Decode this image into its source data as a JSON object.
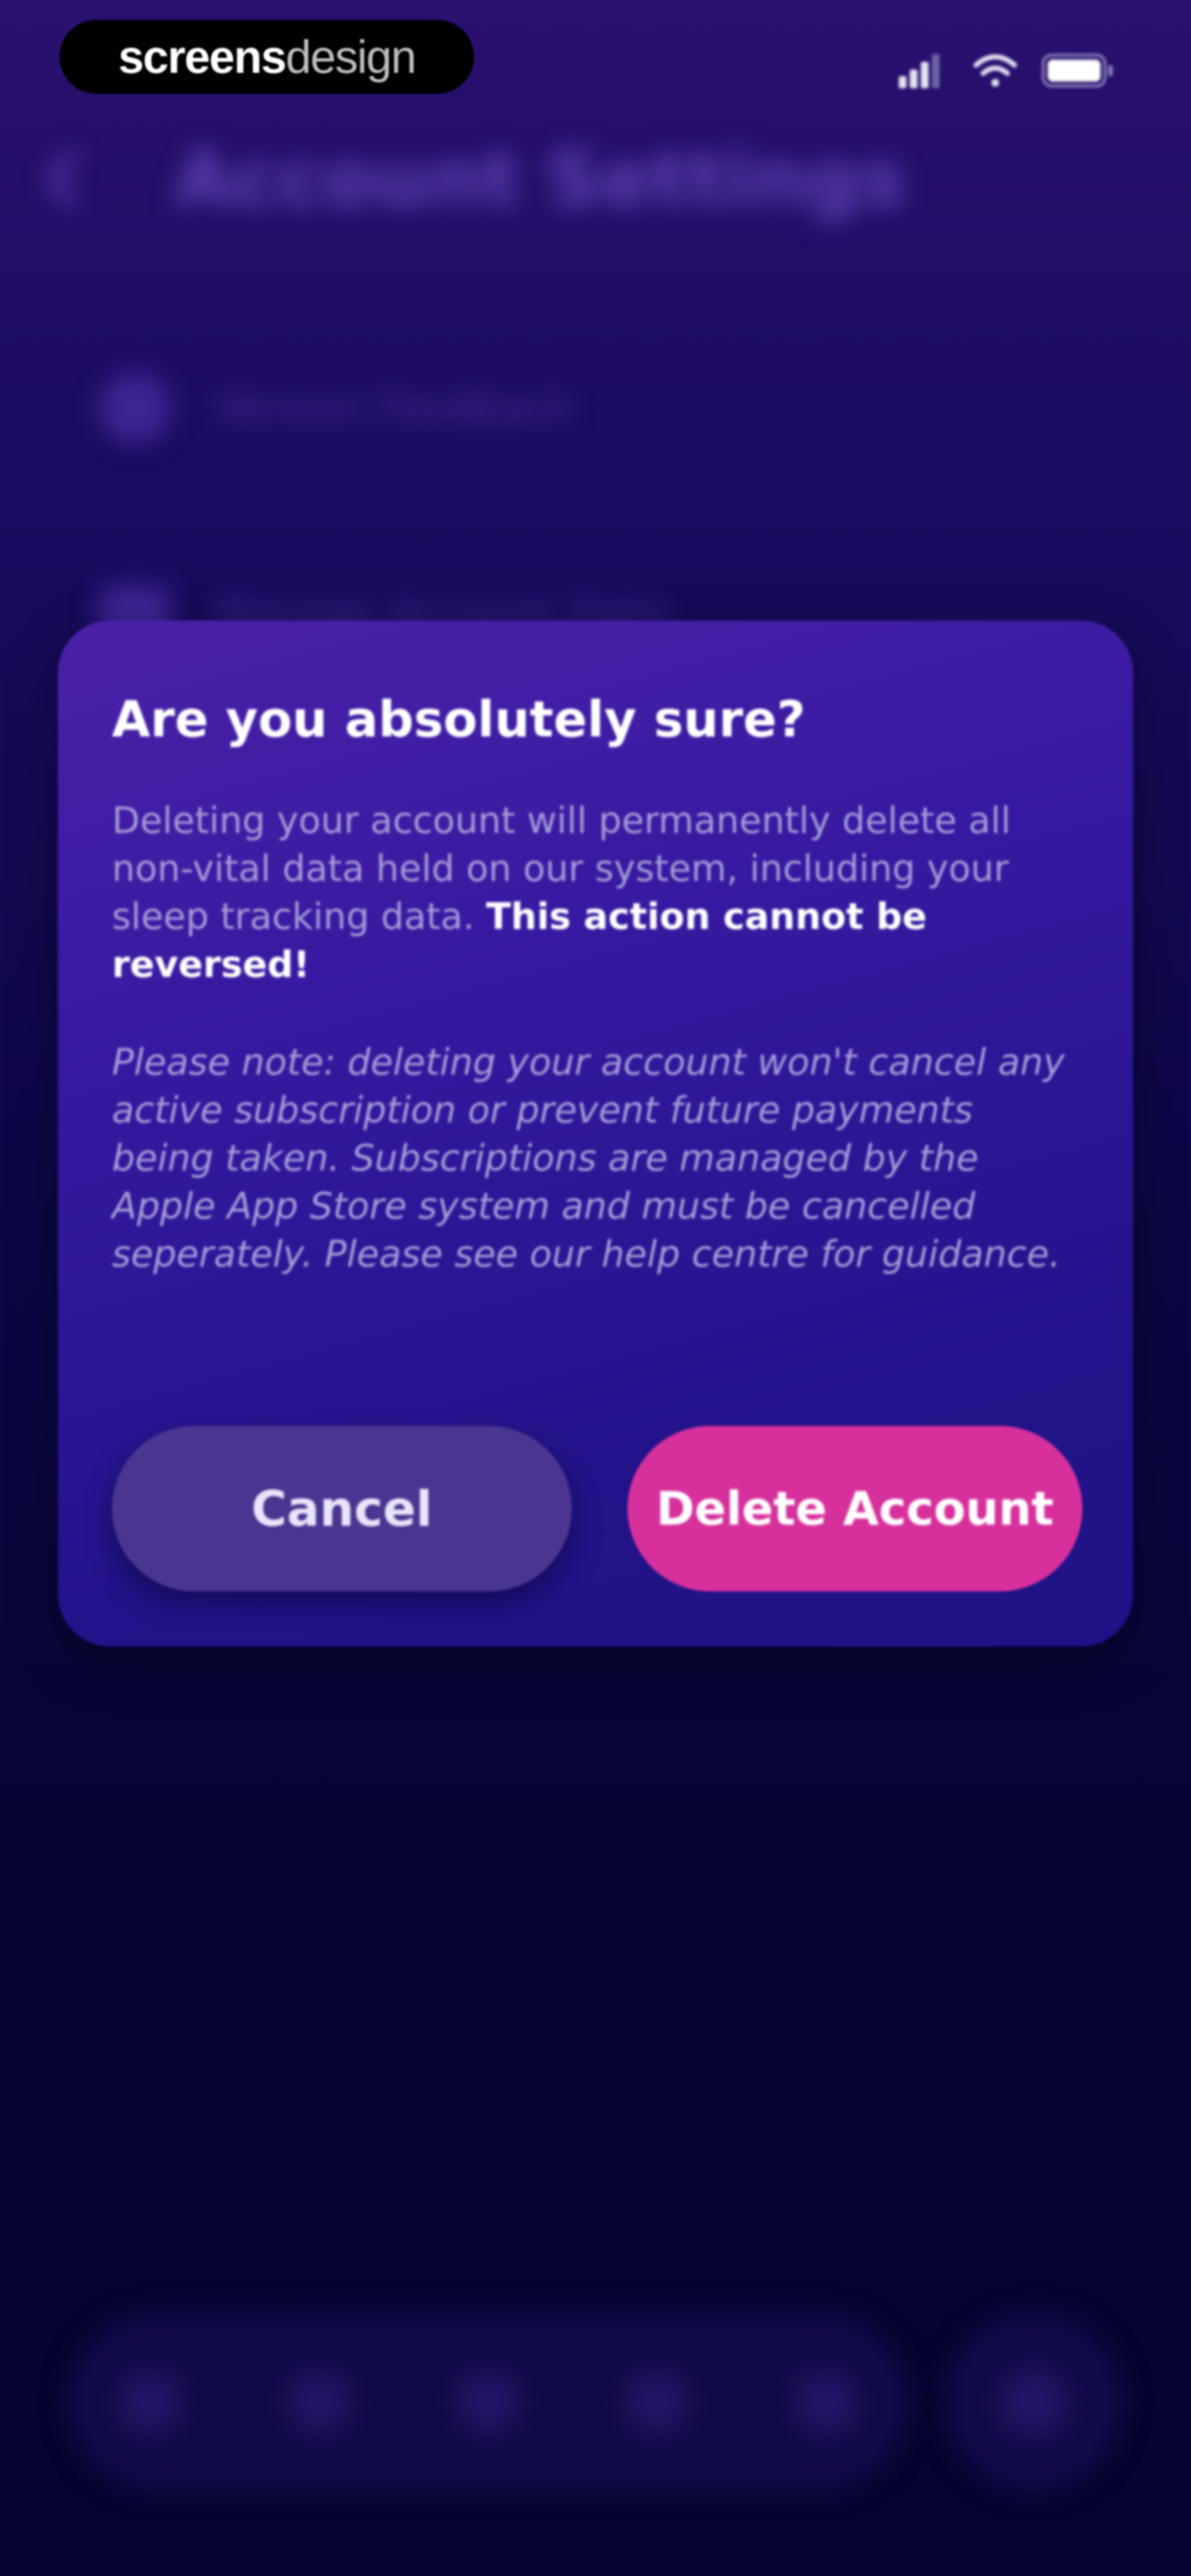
{
  "status_bar": {
    "brand_bold": "screens",
    "brand_light": "design"
  },
  "background": {
    "title": "Account Settings",
    "rows": [
      {
        "label": "Version Feedback"
      },
      {
        "label": "Manage Account Data"
      }
    ]
  },
  "dialog": {
    "title": "Are you absolutely sure?",
    "body_text": "Deleting your account will permanently delete all non-vital data held on our system, including your sleep tracking data.",
    "body_emphasis": "This action cannot be reversed!",
    "note": "Please note: deleting your account won't cancel any active subscription or prevent future payments being taken. Subscriptions are managed by the Apple App Store system and must be cancelled seperately. Please see our help centre for guidance.",
    "cancel_label": "Cancel",
    "delete_label": "Delete Account"
  },
  "colors": {
    "dialog_background": "#3519a0",
    "delete_button": "#d7309c",
    "cancel_button": "#4a3690",
    "screen_background": "#0d0746"
  },
  "icons": {
    "back": "chevron-left-icon",
    "row_1": "user-icon",
    "row_2": "card-icon",
    "signal": "cellular-signal-icon",
    "wifi": "wifi-icon",
    "battery": "battery-icon"
  }
}
